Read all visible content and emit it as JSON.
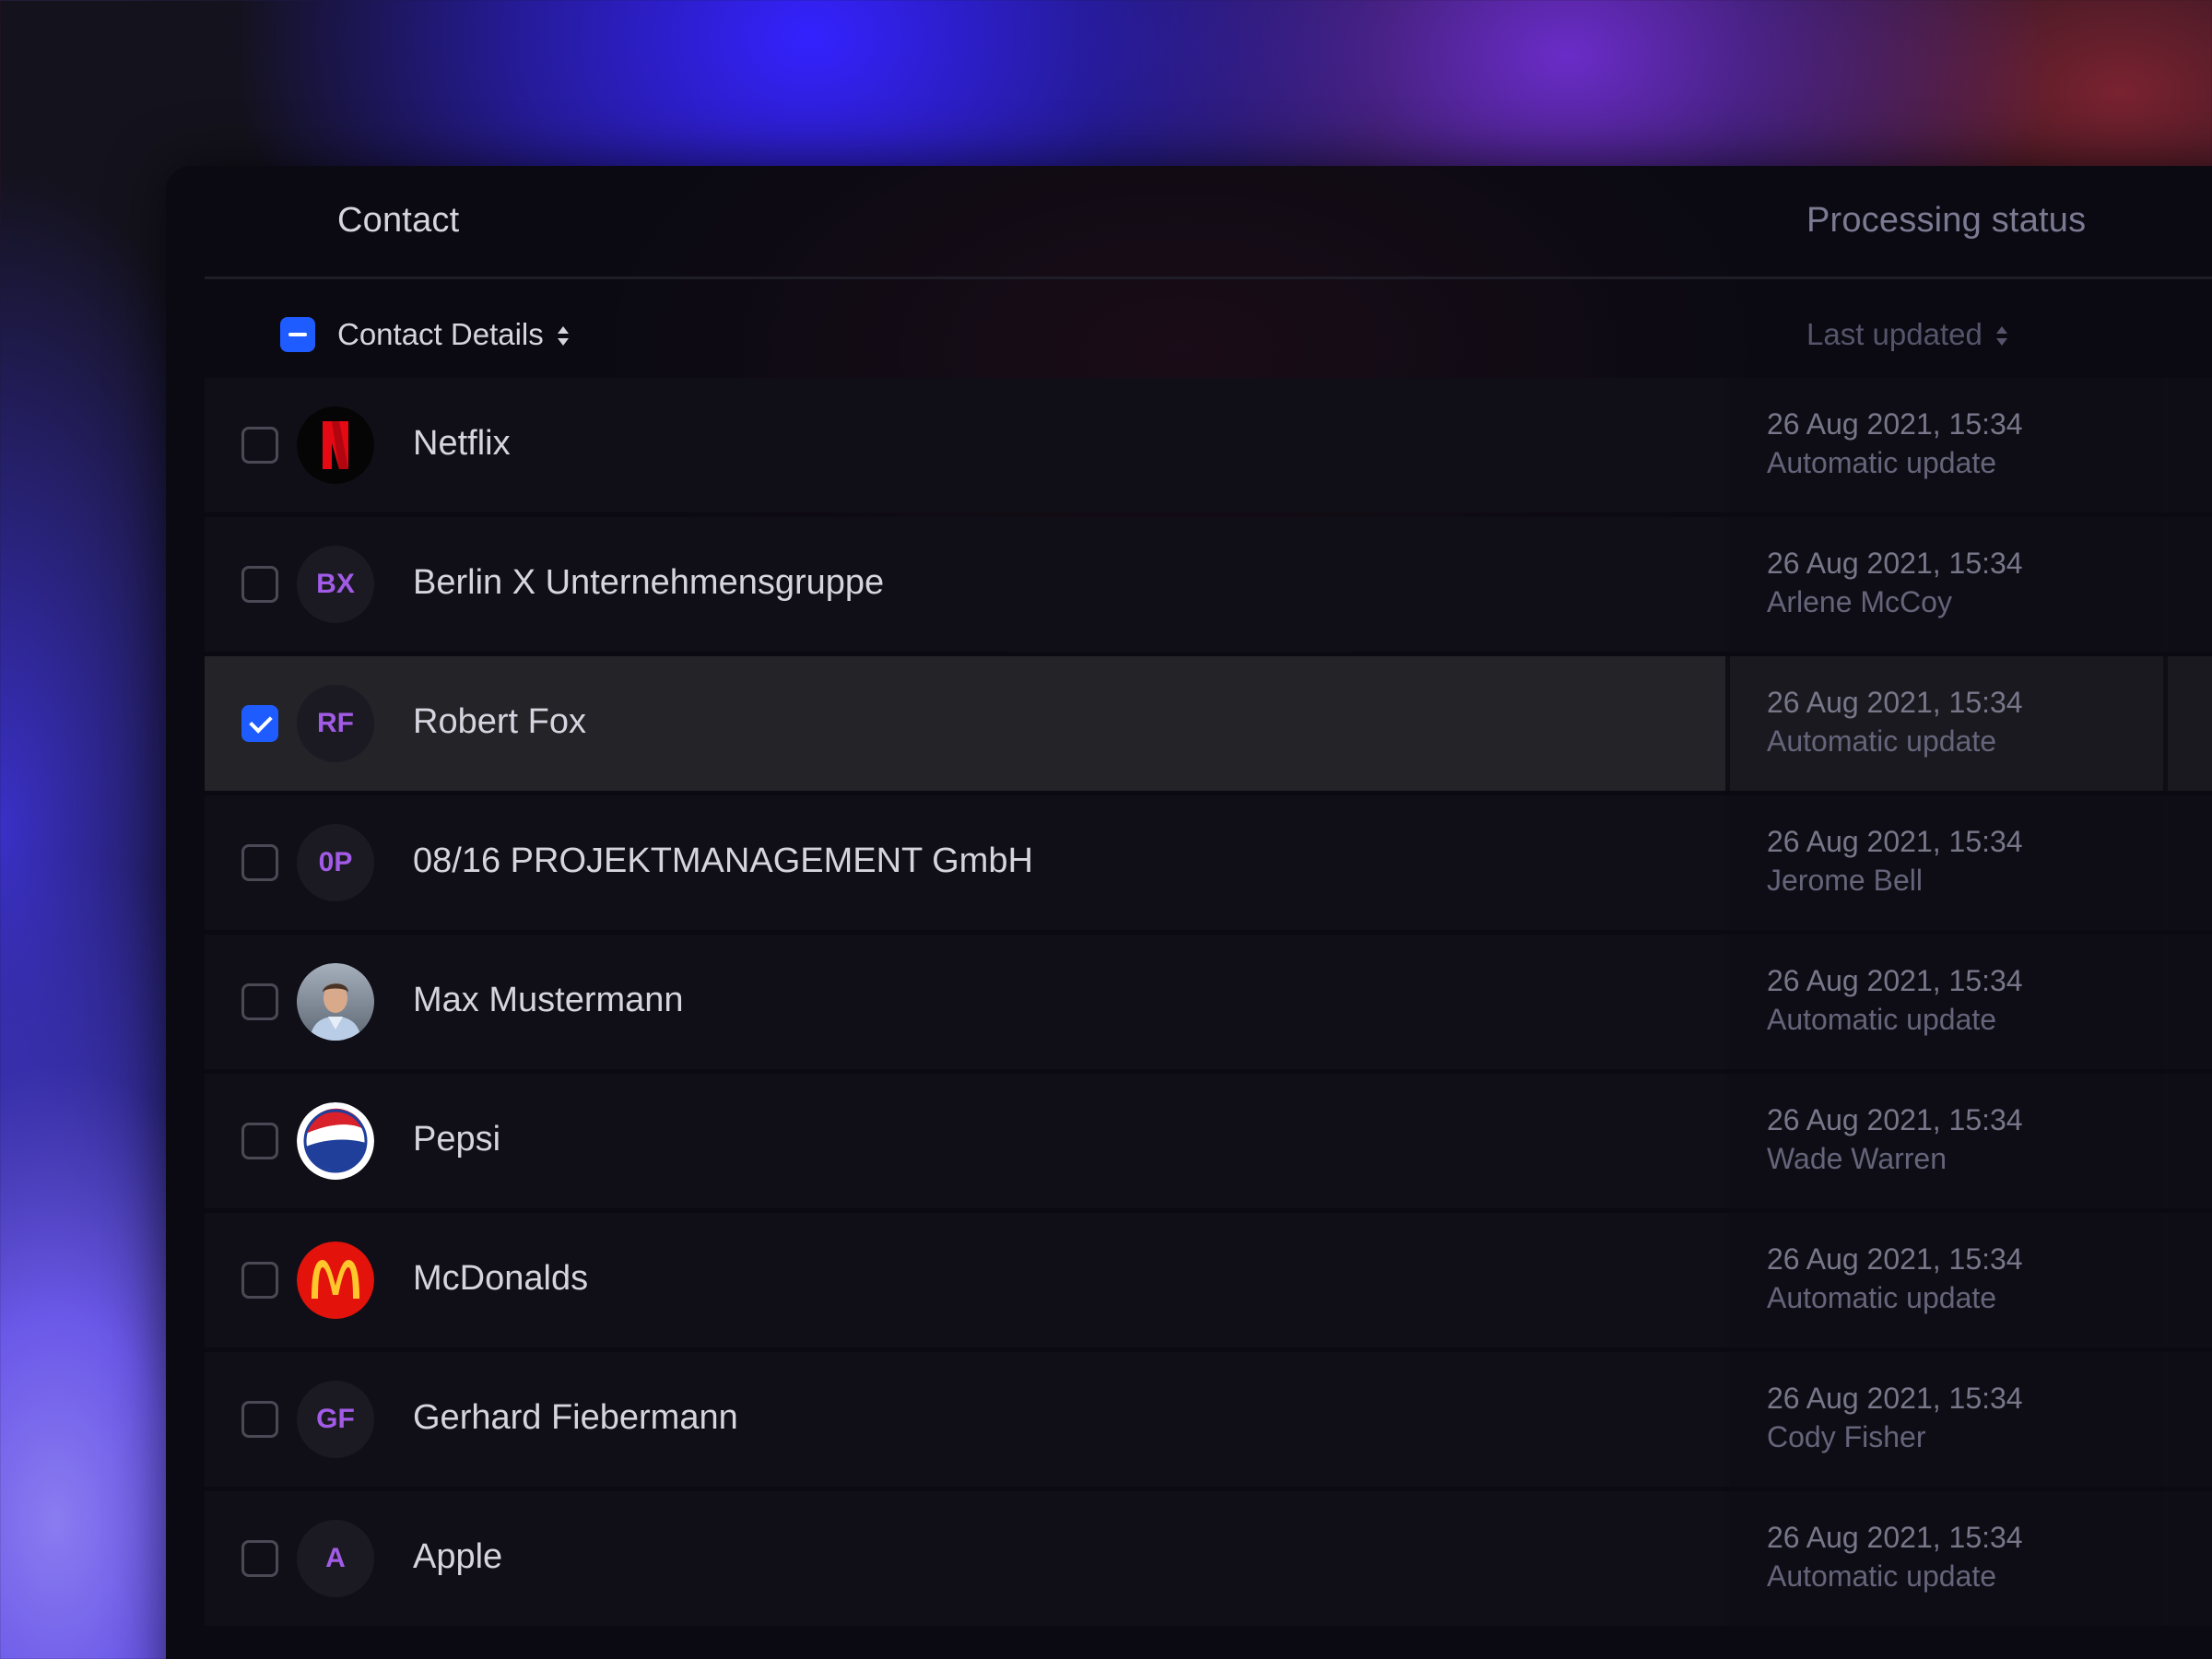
{
  "groups": {
    "contact": "Contact",
    "processing": "Processing status"
  },
  "columns": {
    "contact_details": "Contact Details",
    "last_updated": "Last updated"
  },
  "rows": [
    {
      "name": "Netflix",
      "avatar": "netflix-logo",
      "initials": "",
      "checked": false,
      "date": "26 Aug 2021, 15:34",
      "updater": "Automatic update"
    },
    {
      "name": "Berlin X Unternehmensgruppe",
      "avatar": "initials",
      "initials": "BX",
      "checked": false,
      "date": "26 Aug 2021, 15:34",
      "updater": "Arlene McCoy"
    },
    {
      "name": "Robert Fox",
      "avatar": "initials",
      "initials": "RF",
      "checked": true,
      "date": "26 Aug 2021, 15:34",
      "updater": "Automatic update"
    },
    {
      "name": "08/16 PROJEKTMANAGEMENT GmbH",
      "avatar": "initials",
      "initials": "0P",
      "checked": false,
      "date": "26 Aug 2021, 15:34",
      "updater": "Jerome Bell"
    },
    {
      "name": "Max Mustermann",
      "avatar": "photo",
      "initials": "",
      "checked": false,
      "date": "26 Aug 2021, 15:34",
      "updater": "Automatic update"
    },
    {
      "name": "Pepsi",
      "avatar": "pepsi-logo",
      "initials": "",
      "checked": false,
      "date": "26 Aug 2021, 15:34",
      "updater": "Wade Warren"
    },
    {
      "name": "McDonalds",
      "avatar": "mcdonalds-logo",
      "initials": "",
      "checked": false,
      "date": "26 Aug 2021, 15:34",
      "updater": "Automatic update"
    },
    {
      "name": "Gerhard Fiebermann",
      "avatar": "initials",
      "initials": "GF",
      "checked": false,
      "date": "26 Aug 2021, 15:34",
      "updater": "Cody Fisher"
    },
    {
      "name": "Apple",
      "avatar": "initials",
      "initials": "A",
      "checked": false,
      "date": "26 Aug 2021, 15:34",
      "updater": "Automatic update"
    }
  ],
  "colors": {
    "accent": "#1f5cff",
    "initials": "#a25be6",
    "panel": "#0b0a12"
  }
}
